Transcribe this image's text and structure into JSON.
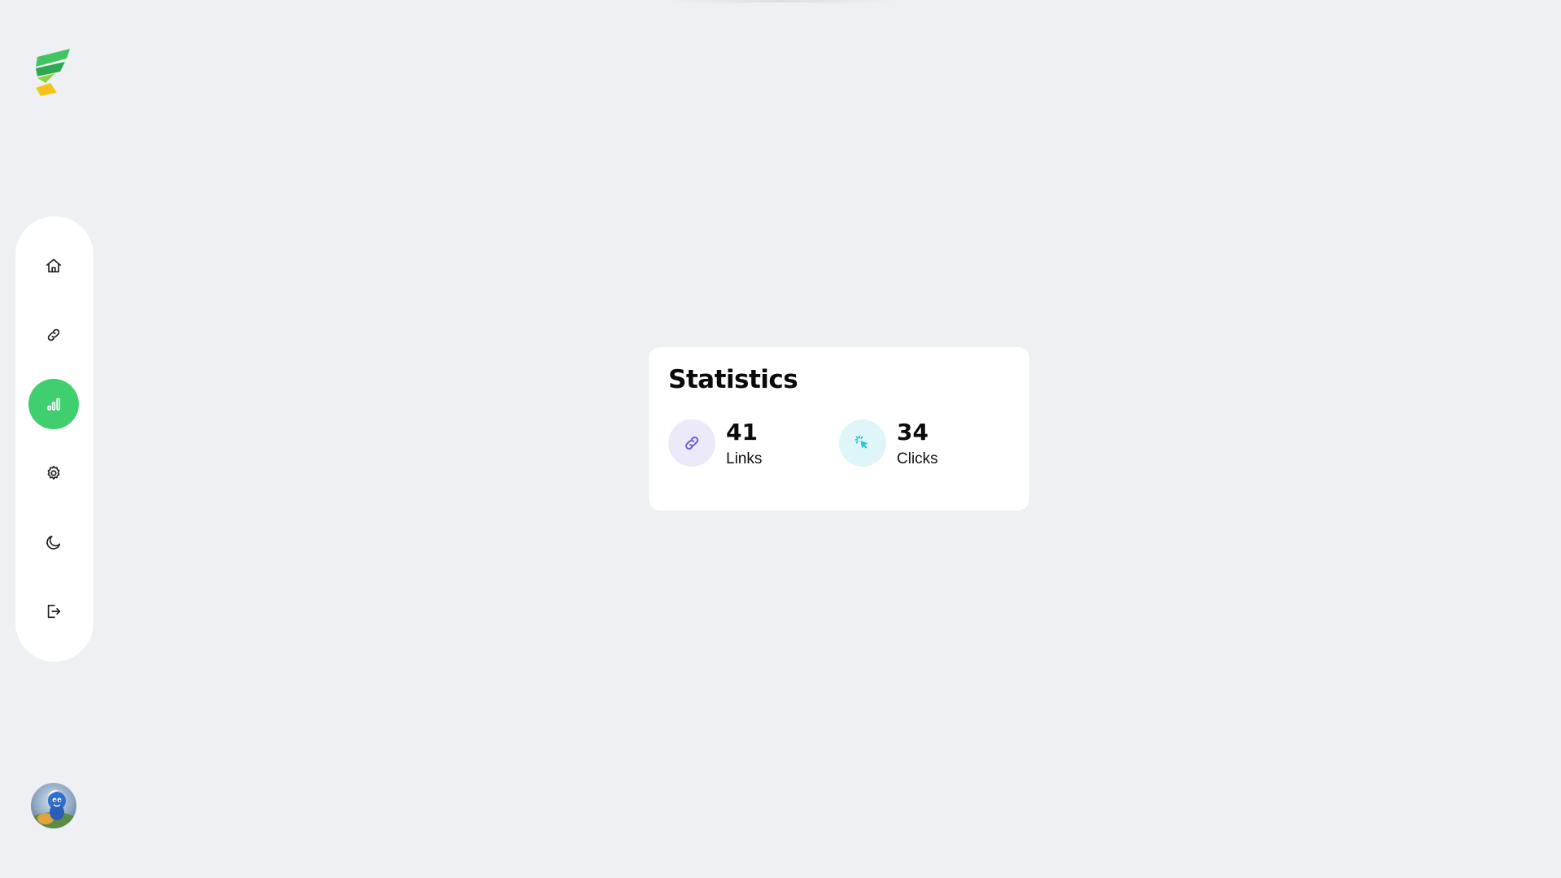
{
  "app": {
    "logo_icon": "brand-logo-icon",
    "brand_colors": {
      "green": "#2fbf55",
      "yellow": "#f5c21b"
    }
  },
  "sidebar": {
    "items": [
      {
        "id": "home",
        "icon": "home-icon",
        "active": false
      },
      {
        "id": "links",
        "icon": "link-icon",
        "active": false
      },
      {
        "id": "statistics",
        "icon": "bar-chart-icon",
        "active": true
      },
      {
        "id": "settings",
        "icon": "gear-icon",
        "active": false
      },
      {
        "id": "theme",
        "icon": "moon-icon",
        "active": false
      },
      {
        "id": "logout",
        "icon": "logout-icon",
        "active": false
      }
    ],
    "active_color": "#3fcf6e"
  },
  "user": {
    "avatar_icon": "user-avatar"
  },
  "statistics": {
    "title": "Statistics",
    "stats": [
      {
        "value": "41",
        "label": "Links",
        "icon": "link-icon",
        "icon_bg": "#ece9fb",
        "icon_color": "#6f5fd6"
      },
      {
        "value": "34",
        "label": "Clicks",
        "icon": "cursor-click-icon",
        "icon_bg": "#dff6f8",
        "icon_color": "#1cc4d4"
      }
    ]
  }
}
